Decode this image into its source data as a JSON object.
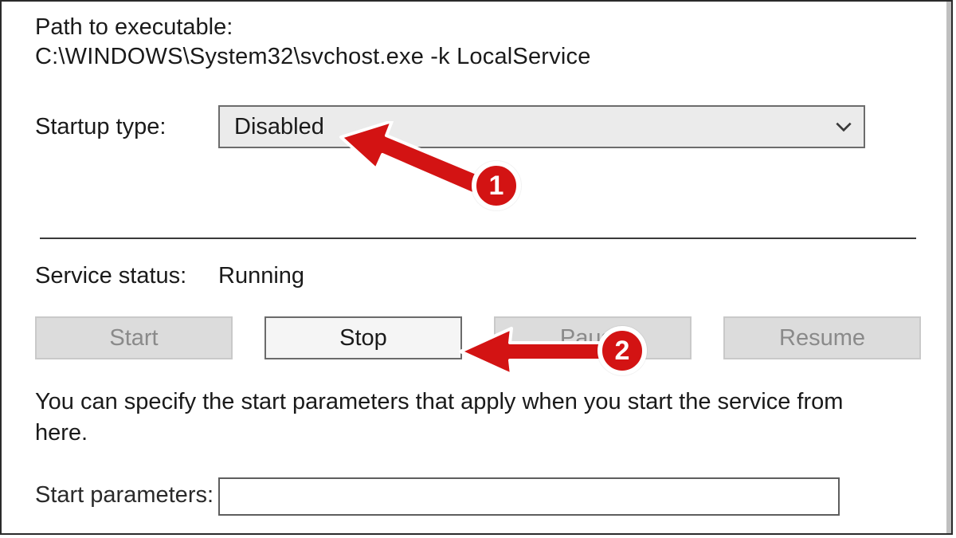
{
  "path": {
    "label": "Path to executable:",
    "value": "C:\\WINDOWS\\System32\\svchost.exe -k LocalService"
  },
  "startup": {
    "label": "Startup type:",
    "selected": "Disabled"
  },
  "service": {
    "status_label": "Service status:",
    "status_value": "Running"
  },
  "buttons": {
    "start": "Start",
    "stop": "Stop",
    "pause": "Pause",
    "resume": "Resume"
  },
  "description": "You can specify the start parameters that apply when you start the service from here.",
  "start_params": {
    "label": "Start parameters:",
    "value": ""
  },
  "annotations": {
    "one": "1",
    "two": "2"
  }
}
